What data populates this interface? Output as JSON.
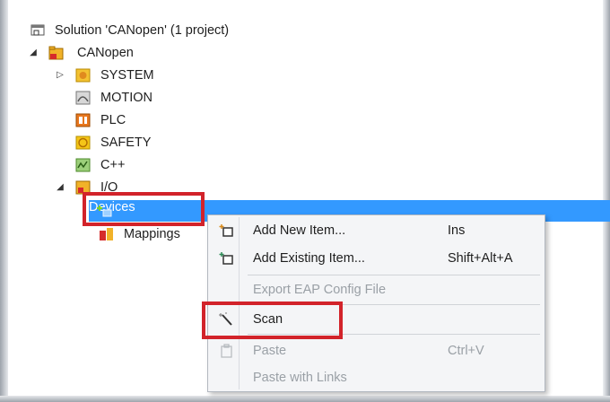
{
  "tree": {
    "solution": "Solution 'CANopen' (1 project)",
    "project": "CANopen",
    "system": "SYSTEM",
    "motion": "MOTION",
    "plc": "PLC",
    "safety": "SAFETY",
    "cpp": "C++",
    "io": "I/O",
    "devices": "Devices",
    "mappings": "Mappings"
  },
  "menu": {
    "add_new": {
      "label": "Add New Item...",
      "shortcut": "Ins"
    },
    "add_existing": {
      "label": "Add Existing Item...",
      "shortcut": "Shift+Alt+A"
    },
    "export": {
      "label": "Export EAP Config File"
    },
    "scan": {
      "label": "Scan"
    },
    "paste": {
      "label": "Paste",
      "shortcut": "Ctrl+V"
    },
    "paste_links": {
      "label": "Paste with Links"
    }
  },
  "colors": {
    "selection": "#3399ff",
    "highlight_border": "#d2232a",
    "menu_background": "#f4f5f7"
  }
}
